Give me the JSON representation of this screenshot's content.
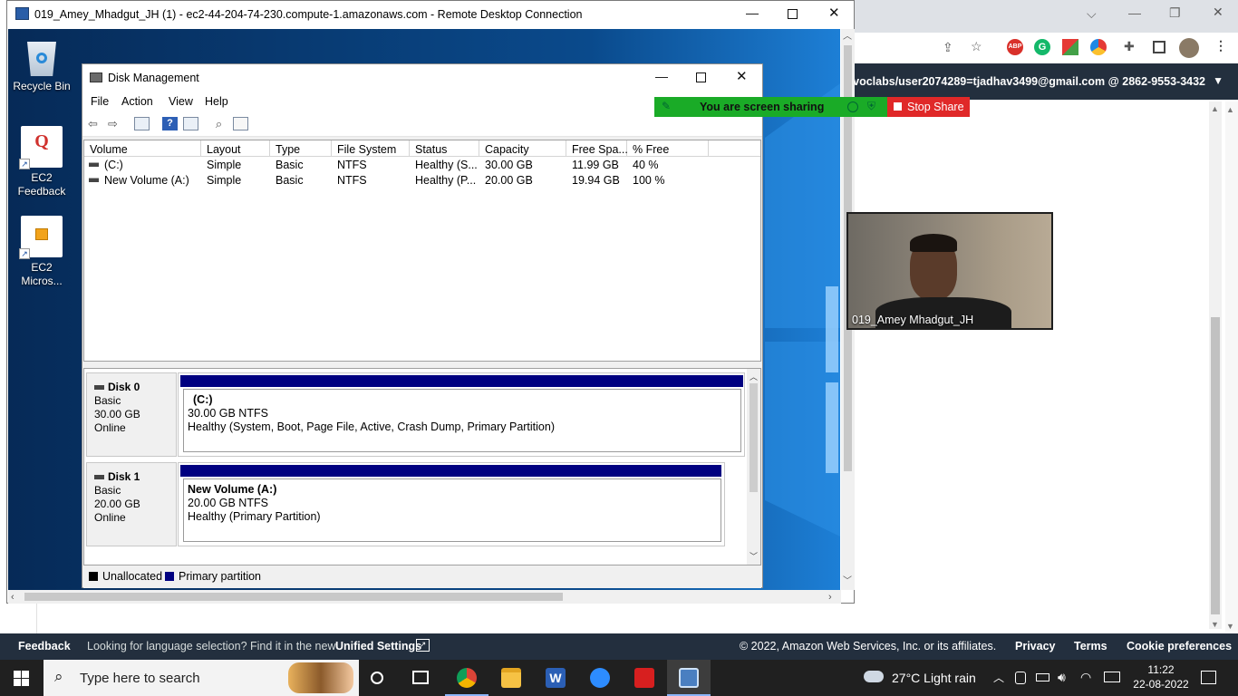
{
  "rdp": {
    "title": "019_Amey_Mhadgut_JH (1) - ec2-44-204-74-230.compute-1.amazonaws.com - Remote Desktop Connection"
  },
  "desktop": {
    "icons": [
      {
        "label": "Recycle Bin"
      },
      {
        "label": "EC2 Feedback",
        "glyph": "Q"
      },
      {
        "label": "EC2 Micros..."
      }
    ]
  },
  "disk_mgmt": {
    "title": "Disk Management",
    "menu": [
      "File",
      "Action",
      "View",
      "Help"
    ],
    "columns": [
      "Volume",
      "Layout",
      "Type",
      "File System",
      "Status",
      "Capacity",
      "Free Spa...",
      "% Free"
    ],
    "volumes": [
      [
        "(C:)",
        "Simple",
        "Basic",
        "NTFS",
        "Healthy (S...",
        "30.00 GB",
        "11.99 GB",
        "40 %"
      ],
      [
        "New Volume (A:)",
        "Simple",
        "Basic",
        "NTFS",
        "Healthy (P...",
        "20.00 GB",
        "19.94 GB",
        "100 %"
      ]
    ],
    "disks": [
      {
        "name": "Disk 0",
        "type": "Basic",
        "size": "30.00 GB",
        "state": "Online",
        "part_name": "(C:)",
        "part_size": "30.00 GB NTFS",
        "part_status": "Healthy (System, Boot, Page File, Active, Crash Dump, Primary Partition)"
      },
      {
        "name": "Disk 1",
        "type": "Basic",
        "size": "20.00 GB",
        "state": "Online",
        "part_name": "New Volume  (A:)",
        "part_size": "20.00 GB NTFS",
        "part_status": "Healthy (Primary Partition)"
      }
    ],
    "legend": [
      {
        "label": "Unallocated",
        "color": "#000000"
      },
      {
        "label": "Primary partition",
        "color": "#000080"
      }
    ]
  },
  "aws": {
    "account": "voclabs/user2074289=tjadhav3499@gmail.com @ 2862-9553-3432",
    "footer": {
      "feedback": "Feedback",
      "language_prefix": "Looking for language selection? Find it in the new",
      "unified_settings": "Unified Settings",
      "copyright": "© 2022, Amazon Web Services, Inc. or its affiliates.",
      "privacy": "Privacy",
      "terms": "Terms",
      "cookies": "Cookie preferences"
    }
  },
  "zoom": {
    "sharing_text": "You are screen sharing",
    "stop_share": "Stop Share",
    "participant": "019_Amey Mhadgut_JH"
  },
  "taskbar": {
    "search_placeholder": "Type here to search",
    "weather": "27°C  Light rain",
    "time": "11:22",
    "date": "22-08-2022"
  },
  "colors": {
    "primary_partition": "#000080",
    "zoom_green": "#1aab27",
    "zoom_red": "#e02828",
    "aws_dark": "#232f3e"
  }
}
